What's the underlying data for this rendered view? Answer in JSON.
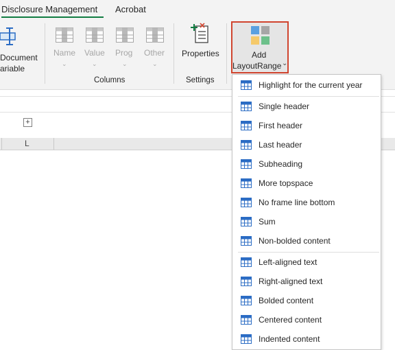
{
  "tabs": [
    {
      "label": "Disclosure Management",
      "active": true
    },
    {
      "label": "Acrobat",
      "active": false
    }
  ],
  "ribbon": {
    "left_button": {
      "line1": "Document",
      "line2": "ariable"
    },
    "columns": [
      {
        "label": "Name"
      },
      {
        "label": "Value"
      },
      {
        "label": "Prog"
      },
      {
        "label": "Other"
      }
    ],
    "columns_group": "Columns",
    "properties_label": "Properties",
    "settings_group": "Settings",
    "add_button": {
      "line1": "Add",
      "line2": "LayoutRange"
    }
  },
  "sheet": {
    "column_letter": "L",
    "expand_symbol": "+"
  },
  "menu": {
    "groups": [
      [
        "Highlight for the current year"
      ],
      [
        "Single header",
        "First header",
        "Last header",
        "Subheading",
        "More topspace",
        "No frame line bottom",
        "Sum",
        "Non-bolded content"
      ],
      [
        "Left-aligned text",
        "Right-aligned text",
        "Bolded content",
        "Centered content",
        "Indented content"
      ]
    ]
  },
  "colors": {
    "accent": "#107c41",
    "highlight_border": "#d0442e",
    "table_icon": "#2b6cc4"
  }
}
